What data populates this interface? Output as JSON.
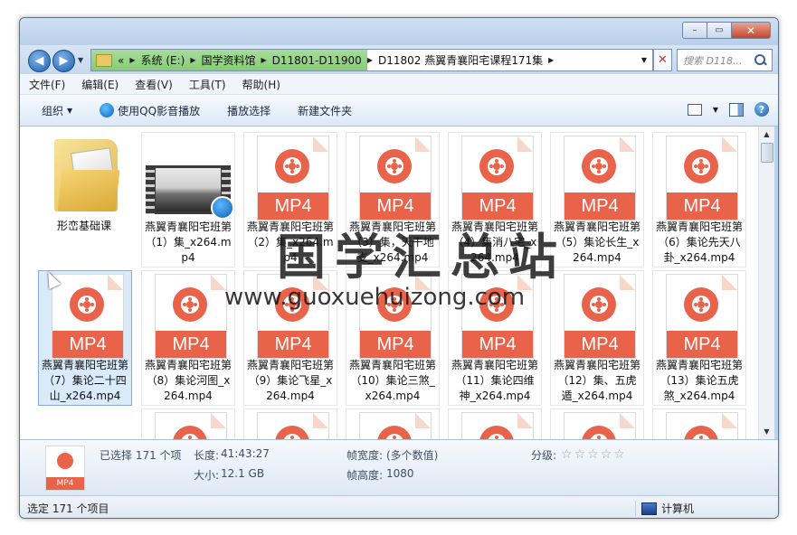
{
  "window": {
    "minimize_glyph": "–",
    "maximize_glyph": "▭",
    "close_glyph": "✕"
  },
  "nav": {
    "back_glyph": "◀",
    "forward_glyph": "▶",
    "dropdown_glyph": "▼"
  },
  "address": {
    "overflow": "«",
    "crumbs": [
      "系统 (E:)",
      "国学资料馆",
      "D11801-D11900"
    ],
    "current": "D11802 燕翼青襄阳宅课程171集",
    "sep": "▶",
    "clear_glyph": "✕"
  },
  "search": {
    "placeholder": "搜索 D118..."
  },
  "menu": {
    "file": "文件(F)",
    "edit": "编辑(E)",
    "view": "查看(V)",
    "tools": "工具(T)",
    "help": "帮助(H)"
  },
  "toolbar": {
    "organize": "组织",
    "qq_play": "使用QQ影音播放",
    "play_selection": "播放选择",
    "new_folder": "新建文件夹",
    "help_glyph": "?"
  },
  "files": [
    {
      "kind": "folder",
      "name": "形峦基础课"
    },
    {
      "kind": "video",
      "name": "燕翼青襄阳宅班第（1）集_x264.mp4"
    },
    {
      "kind": "mp4",
      "name": "燕翼青襄阳宅班第（2）集_x264.mp4"
    },
    {
      "kind": "mp4",
      "name": "燕翼青襄阳宅班第（3）集，天干地支_x264.mp4"
    },
    {
      "kind": "mp4",
      "name": "燕翼青襄阳宅班第（4）集消八宅_x264.mp4"
    },
    {
      "kind": "mp4",
      "name": "燕翼青襄阳宅班第（5）集论长生_x264.mp4"
    },
    {
      "kind": "mp4",
      "name": "燕翼青襄阳宅班第（6）集论先天八卦_x264.mp4"
    },
    {
      "kind": "mp4",
      "name": "燕翼青襄阳宅班第（7）集论二十四山_x264.mp4",
      "selected": true
    },
    {
      "kind": "mp4",
      "name": "燕翼青襄阳宅班第（8）集论河图_x264.mp4"
    },
    {
      "kind": "mp4",
      "name": "燕翼青襄阳宅班第（9）集论飞星_x264.mp4"
    },
    {
      "kind": "mp4",
      "name": "燕翼青襄阳宅班第（10）集论三煞_x264.mp4"
    },
    {
      "kind": "mp4",
      "name": "燕翼青襄阳宅班第（11）集论四维神_x264.mp4"
    },
    {
      "kind": "mp4",
      "name": "燕翼青襄阳宅班第（12）集、五虎遁_x264.mp4"
    },
    {
      "kind": "mp4",
      "name": "燕翼青襄阳宅班第（13）集论五虎煞_x264.mp4"
    }
  ],
  "mp4_label": "MP4",
  "details": {
    "selected_text": "已选择 171 个项",
    "length_label": "长度:",
    "length_value": "41:43:27",
    "size_label": "大小:",
    "size_value": "12.1 GB",
    "frame_width_label": "帧宽度:",
    "frame_width_value": "(多个数值)",
    "frame_height_label": "帧高度:",
    "frame_height_value": "1080",
    "rating_label": "分级:",
    "rating_stars": 0,
    "icon_label": "MP4"
  },
  "status": {
    "left": "选定 171 个项目",
    "right": "计算机"
  },
  "watermark": {
    "cn": "国学汇总站",
    "url": "www.guoxuehuizong.com"
  }
}
